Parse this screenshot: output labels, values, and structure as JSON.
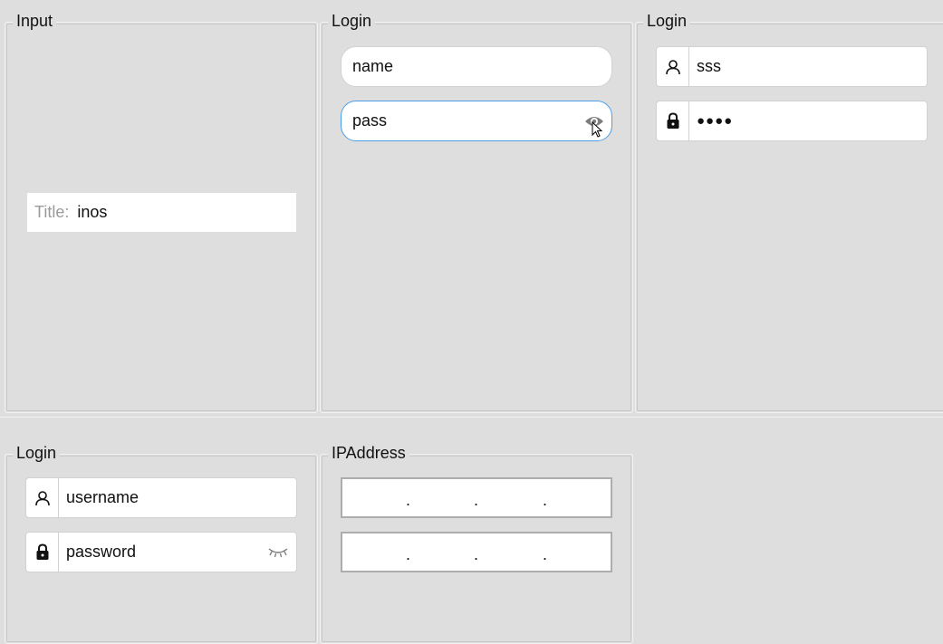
{
  "panels": {
    "input": {
      "title": "Input",
      "title_field": {
        "label": "Title:",
        "value": "inos"
      }
    },
    "login_pill": {
      "title": "Login",
      "name_value": "name",
      "pass_value": "pass"
    },
    "login_icons": {
      "title": "Login",
      "user_value": "sss",
      "password_masked": "●●●●"
    },
    "login_placeholder": {
      "title": "Login",
      "username_placeholder": "username",
      "password_placeholder": "password"
    },
    "ipaddress": {
      "title": "IPAddress",
      "separator": "."
    }
  },
  "icons": [
    "user-icon",
    "lock-icon",
    "eye-icon",
    "eye-closed-icon",
    "mouse-cursor-icon"
  ],
  "colors": {
    "background": "#dedede",
    "focus_border": "#4a9ee8",
    "placeholder": "#9a9a9a"
  }
}
